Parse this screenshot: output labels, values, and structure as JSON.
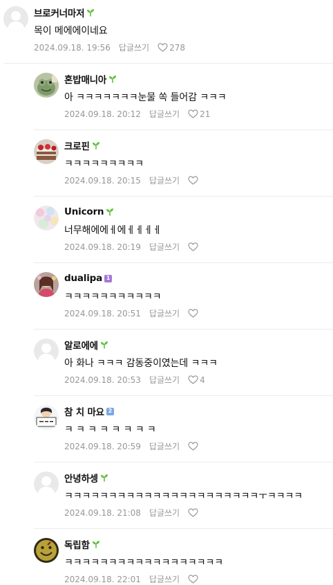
{
  "icons": {
    "sprout": "sprout-icon",
    "heart": "heart-outline-icon",
    "level": "level-badge-icon"
  },
  "colors": {
    "sprout": "#5fbf3c",
    "level_purple": "#a47ad8",
    "level_blue": "#7aa6e6",
    "meta_text": "#979797",
    "divider": "#ececec"
  },
  "comments": [
    {
      "nickname": "브로커너마저",
      "badge": "sprout",
      "text": "목이 메에에이네요",
      "date": "2024.09.18. 19:56",
      "reply_label": "답글쓰기",
      "likes": "278",
      "avatar": "default"
    },
    {
      "nickname": "혼밥매니아",
      "badge": "sprout",
      "text": "아 ㅋㅋㅋㅋㅋㅋㅋ눈물 쏙 들어감 ㅋㅋㅋ",
      "date": "2024.09.18. 20:12",
      "reply_label": "답글쓰기",
      "likes": "21",
      "avatar": "frog"
    },
    {
      "nickname": "크로핀",
      "badge": "sprout",
      "text": "ㅋㅋㅋㅋㅋㅋㅋㅋㅋ",
      "date": "2024.09.18. 20:15",
      "reply_label": "답글쓰기",
      "likes": "",
      "avatar": "cake"
    },
    {
      "nickname": "Unicorn",
      "badge": "sprout",
      "text": "너무해에에ㅔ에ㅔㅔㅔㅔ",
      "date": "2024.09.18. 20:19",
      "reply_label": "답글쓰기",
      "likes": "",
      "avatar": "pastel"
    },
    {
      "nickname": "dualipa",
      "badge": "level",
      "badge_text": "1",
      "text": "ㅋㅋㅋㅋㅋㅋㅋㅋㅋㅋㅋ",
      "date": "2024.09.18. 20:51",
      "reply_label": "답글쓰기",
      "likes": "",
      "avatar": "person"
    },
    {
      "nickname": "알로에에",
      "badge": "sprout",
      "text": "아 화나 ㅋㅋㅋ 감동중이였는데 ㅋㅋㅋ",
      "date": "2024.09.18. 20:53",
      "reply_label": "답글쓰기",
      "likes": "4",
      "avatar": "default"
    },
    {
      "nickname": "참 치 마요",
      "badge": "level",
      "badge_text": "2",
      "text": "ㅋ ㅋ ㅋ ㅋ ㅋ ㅋ ㅋ ㅋ",
      "date": "2024.09.18. 20:59",
      "reply_label": "답글쓰기",
      "likes": "",
      "avatar": "sign"
    },
    {
      "nickname": "안녕하셍",
      "badge": "sprout",
      "text": "ㅋㅋㅋㅋㅋㅋㅋㅋㅋㅋㅋㅋㅋㅋㅋㅋㅋㅋㅋㅋㅋㅋㅜㅋㅋㅋㅋ",
      "date": "2024.09.18. 21:08",
      "reply_label": "답글쓰기",
      "likes": "",
      "avatar": "default"
    },
    {
      "nickname": "독립함",
      "badge": "sprout",
      "text": "ㅋㅋㅋㅋㅋㅋㅋㅋㅋㅋㅋㅋㅋㅋㅋㅋㅋㅋ",
      "date": "2024.09.18. 22:01",
      "reply_label": "답글쓰기",
      "likes": "",
      "avatar": "smiley"
    }
  ]
}
